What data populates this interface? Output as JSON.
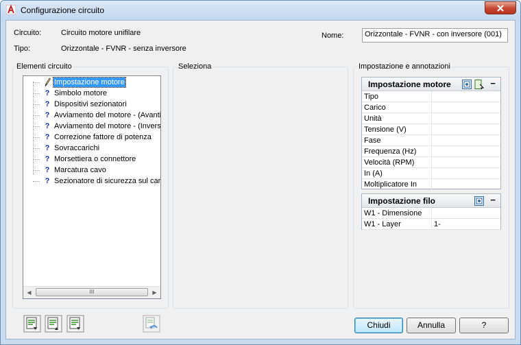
{
  "window": {
    "title": "Configurazione circuito",
    "app_icon": "autocad-a-icon",
    "close_icon": "close-x-icon",
    "accent": "#c1272d"
  },
  "header": {
    "circuito_label": "Circuito:",
    "circuito_value": "Circuito motore unifilare",
    "tipo_label": "Tipo:",
    "tipo_value": "Orizzontale - FVNR - senza inversore",
    "nome_label": "Nome:",
    "nome_value": "Orizzontale - FVNR - con inversore (001)"
  },
  "elements": {
    "group_title": "Elementi circuito",
    "items": [
      {
        "label": "Impostazione motore",
        "icon": "pencil-icon",
        "selected": true
      },
      {
        "label": "Simbolo motore",
        "icon": "question-icon"
      },
      {
        "label": "Dispositivi sezionatori",
        "icon": "question-icon"
      },
      {
        "label": "Avviamento del motore - (Avanti)",
        "icon": "question-icon"
      },
      {
        "label": "Avviamento del motore - (Inversione)",
        "icon": "question-icon"
      },
      {
        "label": "Correzione fattore di potenza",
        "icon": "question-icon"
      },
      {
        "label": "Sovraccarichi",
        "icon": "question-icon"
      },
      {
        "label": "Morsettiera o connettore",
        "icon": "question-icon"
      },
      {
        "label": "Marcatura cavo",
        "icon": "question-icon"
      },
      {
        "label": "Sezionatore di sicurezza sul carico",
        "icon": "question-icon"
      }
    ],
    "scroll_thumb": "III"
  },
  "selection": {
    "group_title": "Seleziona"
  },
  "settings": {
    "group_title": "Impostazione e annotazioni",
    "motor": {
      "title": "Impostazione motore",
      "collapse": "−",
      "rows": [
        {
          "label": "Tipo",
          "value": ""
        },
        {
          "label": "Carico",
          "value": ""
        },
        {
          "label": "Unità",
          "value": ""
        },
        {
          "label": "Tensione (V)",
          "value": ""
        },
        {
          "label": "Fase",
          "value": ""
        },
        {
          "label": "Frequenza (Hz)",
          "value": ""
        },
        {
          "label": "Velocità (RPM)",
          "value": ""
        },
        {
          "label": "In (A)",
          "value": ""
        },
        {
          "label": "Moltiplicatore In",
          "value": ""
        }
      ]
    },
    "wire": {
      "title": "Impostazione filo",
      "collapse": "−",
      "rows": [
        {
          "label": "W1 - Dimensione",
          "value": ""
        },
        {
          "label": "W1 - Layer",
          "value": "1-"
        }
      ]
    }
  },
  "footer": {
    "tools": [
      "add-element-icon",
      "move-up-icon",
      "move-down-icon",
      "undo-edit-icon"
    ],
    "ok": "Chiudi",
    "cancel": "Annulla",
    "help": "?"
  }
}
